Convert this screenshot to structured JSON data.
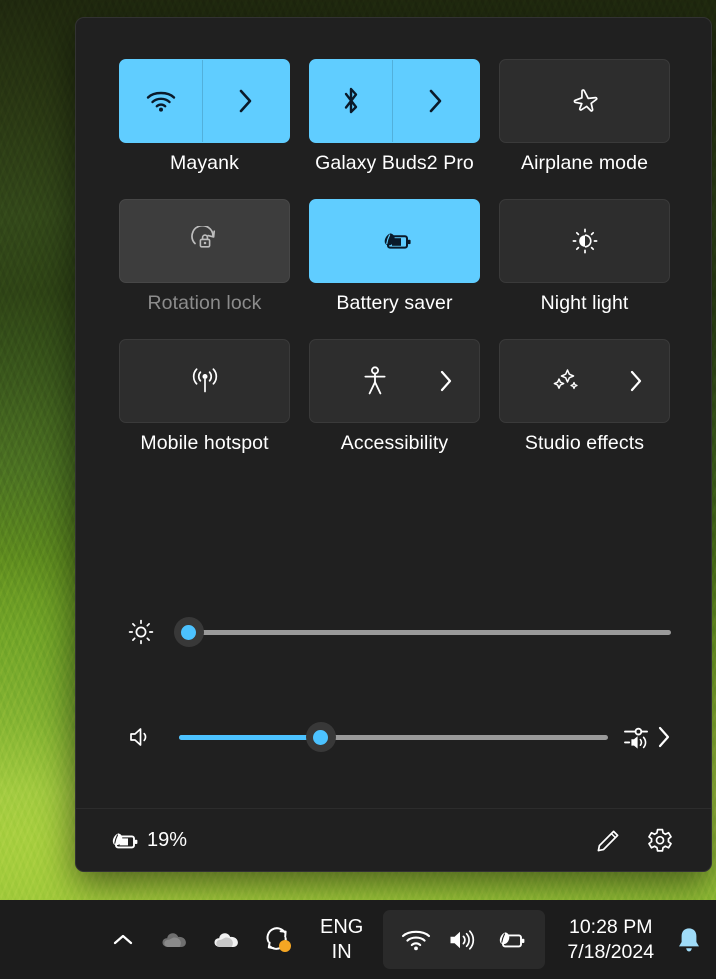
{
  "wallpaper": {
    "description": "tea-plantation-green-foliage"
  },
  "quick_settings": {
    "tiles": [
      {
        "label": "Mayank",
        "icon": "wifi-icon",
        "state": "on",
        "has_chevron": true,
        "split": true
      },
      {
        "label": "Galaxy Buds2 Pro",
        "icon": "bluetooth-icon",
        "state": "on",
        "has_chevron": true,
        "split": true
      },
      {
        "label": "Airplane mode",
        "icon": "airplane-icon",
        "state": "off",
        "has_chevron": false,
        "split": false
      },
      {
        "label": "Rotation lock",
        "icon": "rotation-lock-icon",
        "state": "disabled",
        "has_chevron": false,
        "split": false
      },
      {
        "label": "Battery saver",
        "icon": "battery-saver-icon",
        "state": "on",
        "has_chevron": false,
        "split": false
      },
      {
        "label": "Night light",
        "icon": "night-light-icon",
        "state": "off",
        "has_chevron": false,
        "split": false
      },
      {
        "label": "Mobile hotspot",
        "icon": "hotspot-icon",
        "state": "off",
        "has_chevron": false,
        "split": false
      },
      {
        "label": "Accessibility",
        "icon": "accessibility-icon",
        "state": "off",
        "has_chevron": true,
        "split": false
      },
      {
        "label": "Studio effects",
        "icon": "sparkle-icon",
        "state": "off",
        "has_chevron": true,
        "split": false
      }
    ],
    "brightness": {
      "icon": "brightness-icon",
      "value": 2,
      "max": 100
    },
    "volume": {
      "icon": "volume-icon",
      "value": 33,
      "max": 100,
      "trailing_icon": "audio-output-icon"
    },
    "footer": {
      "battery_icon": "battery-saver-icon",
      "battery_percent": "19%",
      "edit_label": "edit-quick-settings",
      "settings_label": "open-settings"
    }
  },
  "taskbar": {
    "tray_left": [
      {
        "icon": "chevron-up-icon",
        "name": "show-hidden-icons"
      },
      {
        "icon": "onedrive-gray-icon",
        "name": "onedrive-personal"
      },
      {
        "icon": "onedrive-white-icon",
        "name": "onedrive-business"
      },
      {
        "icon": "sync-icon",
        "name": "sync-status",
        "badge": "#f5a623"
      }
    ],
    "language": {
      "line1": "ENG",
      "line2": "IN"
    },
    "tray_pill": [
      {
        "icon": "wifi-icon",
        "name": "tray-network"
      },
      {
        "icon": "volume-icon",
        "name": "tray-volume"
      },
      {
        "icon": "battery-saver-icon",
        "name": "tray-battery"
      }
    ],
    "clock": {
      "time": "10:28 PM",
      "date": "7/18/2024"
    },
    "notifications": {
      "icon": "bell-icon",
      "color": "#9fdcf8"
    }
  },
  "colors": {
    "accent": "#60cdff",
    "slider_accent": "#4cc2ff",
    "panel_bg": "#202020",
    "tile_off": "#2d2d2d",
    "tile_disabled": "#3d3d3d",
    "taskbar_bg": "#1c1c1c",
    "badge_orange": "#f5a623"
  }
}
